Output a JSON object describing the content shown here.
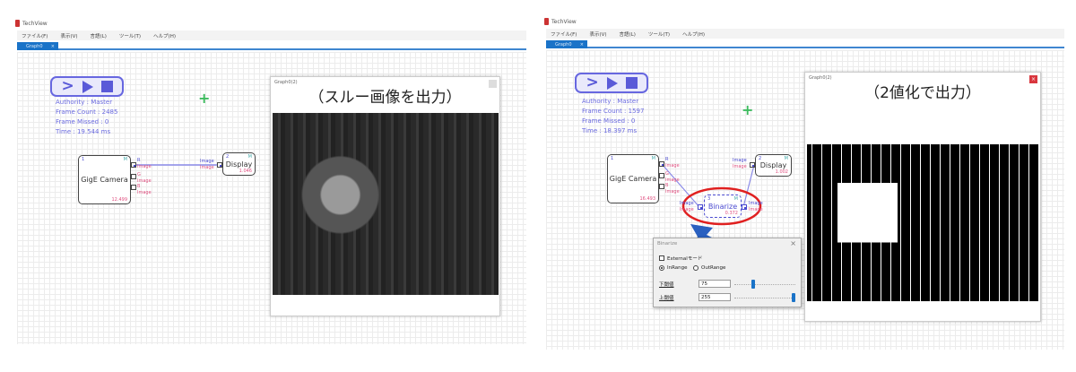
{
  "app_title": "TechView",
  "menu": [
    "ファイル(F)",
    "表示(V)",
    "言語(L)",
    "ツール(T)",
    "ヘルプ(H)"
  ],
  "tab_label": "Graph0",
  "tab_close": "×",
  "left": {
    "stats": {
      "authority": "Authority : Master",
      "frame_count": "Frame Count : 2485",
      "frame_missed": "Frame Missed : 0",
      "time": "Time :  19.544 ms"
    },
    "camera": {
      "id": "1",
      "mode": "M",
      "name": "GigE Camera",
      "time": "12.499",
      "ports": [
        "R",
        "Image",
        "G",
        "Image",
        "B",
        "Image"
      ]
    },
    "display": {
      "id": "2",
      "mode": "M",
      "name": "Display",
      "time": "1.046",
      "in_labels": [
        "Image",
        "Image"
      ]
    },
    "preview": {
      "title": "Graph0(2)",
      "caption": "（スルー画像を出力）"
    }
  },
  "right": {
    "stats": {
      "authority": "Authority : Master",
      "frame_count": "Frame Count : 1597",
      "frame_missed": "Frame Missed : 0",
      "time": "Time :  18.397 ms"
    },
    "camera": {
      "id": "1",
      "mode": "M",
      "name": "GigE Camera",
      "time": "16.493",
      "ports": [
        "R",
        "Image",
        "G",
        "Image",
        "B",
        "Image"
      ]
    },
    "display": {
      "id": "2",
      "mode": "M",
      "name": "Display",
      "time": "1.002",
      "in_labels": [
        "Image",
        "Image"
      ]
    },
    "binarize": {
      "id": "3",
      "mode": "M",
      "name": "Binarize",
      "time": "0.372",
      "in_labels": [
        "Image",
        "Image"
      ],
      "out_labels": [
        "Image",
        "Image"
      ]
    },
    "highlight_color": "#e02020",
    "preview": {
      "title": "Graph0(2)",
      "caption": "（2値化で出力）",
      "close": "×"
    },
    "dialog": {
      "title": "Binarize",
      "close": "×",
      "external_mode": {
        "label": "Externalモード",
        "checked": false
      },
      "range_options": [
        {
          "label": "InRange",
          "selected": true
        },
        {
          "label": "OutRange",
          "selected": false
        }
      ],
      "lower": {
        "label": "下閾値",
        "value": "75",
        "slider_fraction": 0.29
      },
      "upper": {
        "label": "上閾値",
        "value": "255",
        "slider_fraction": 1.0
      }
    }
  },
  "colors": {
    "accent": "#1a73c8",
    "node_blue": "#5a5ad8",
    "port_label": "#e05080",
    "plus": "#3dbb5e"
  }
}
